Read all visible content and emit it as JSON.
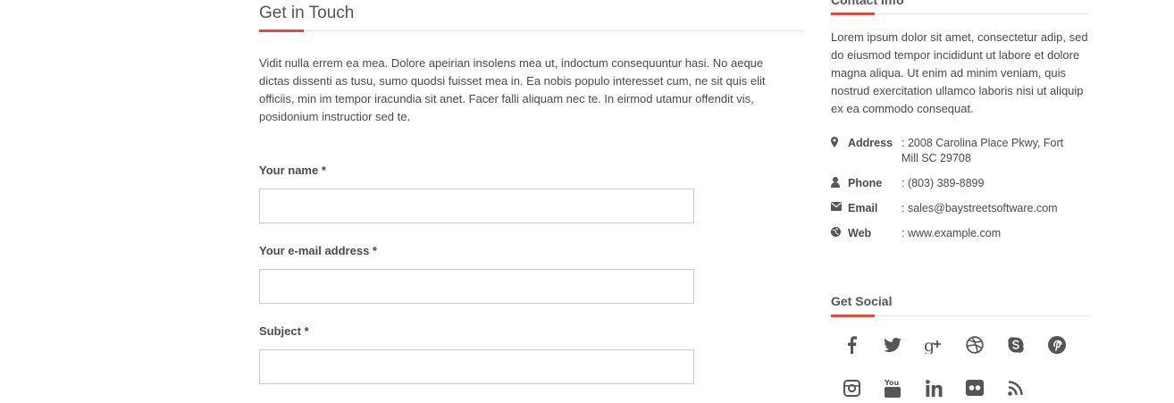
{
  "main": {
    "title": "Get in Touch",
    "intro": "Vidit nulla errem ea mea. Dolore apeirian insolens mea ut, indoctum consequuntur hasi. No aeque dictas dissenti as tusu, sumo quodsi fuisset mea in. Ea nobis populo interesset cum, ne sit quis elit officiis, min im tempor iracundia sit anet. Facer falli aliquam nec te. In eirmod utamur offendit vis, posidonium instructior sed te.",
    "form": {
      "name_label": "Your name *",
      "email_label": "Your e-mail address *",
      "subject_label": "Subject *",
      "name_value": "",
      "email_value": "",
      "subject_value": ""
    }
  },
  "sidebar": {
    "contact_title": "Contact Info",
    "contact_text": "Lorem ipsum dolor sit amet, consectetur adip, sed do eiusmod tempor incididunt ut labore et dolore magna aliqua. Ut enim ad minim veniam, quis nostrud exercitation ullamco laboris nisi ut aliquip ex ea commodo consequat.",
    "contacts": [
      {
        "icon": "map-marker-icon",
        "label": "Address",
        "value": ": 2008 Carolina Place Pkwy, Fort Mill SC 29708"
      },
      {
        "icon": "user-icon",
        "label": "Phone",
        "value": ": (803) 389-8899"
      },
      {
        "icon": "envelope-icon",
        "label": "Email",
        "value": ": sales@baystreetsoftware.com"
      },
      {
        "icon": "globe-icon",
        "label": "Web",
        "value": ": www.example.com"
      }
    ],
    "social_title": "Get Social",
    "social_icons": [
      "facebook-icon",
      "twitter-icon",
      "google-plus-icon",
      "dribbble-icon",
      "skype-icon",
      "pinterest-icon",
      "instagram-icon",
      "youtube-icon",
      "linkedin-icon",
      "flickr-icon",
      "rss-icon"
    ],
    "social_icon_texts": {
      "youtube": "You"
    }
  },
  "colors": {
    "accent": "#e04a3f",
    "text": "#4a4a4a",
    "icon": "#555555",
    "rule": "#e3e3e3"
  }
}
